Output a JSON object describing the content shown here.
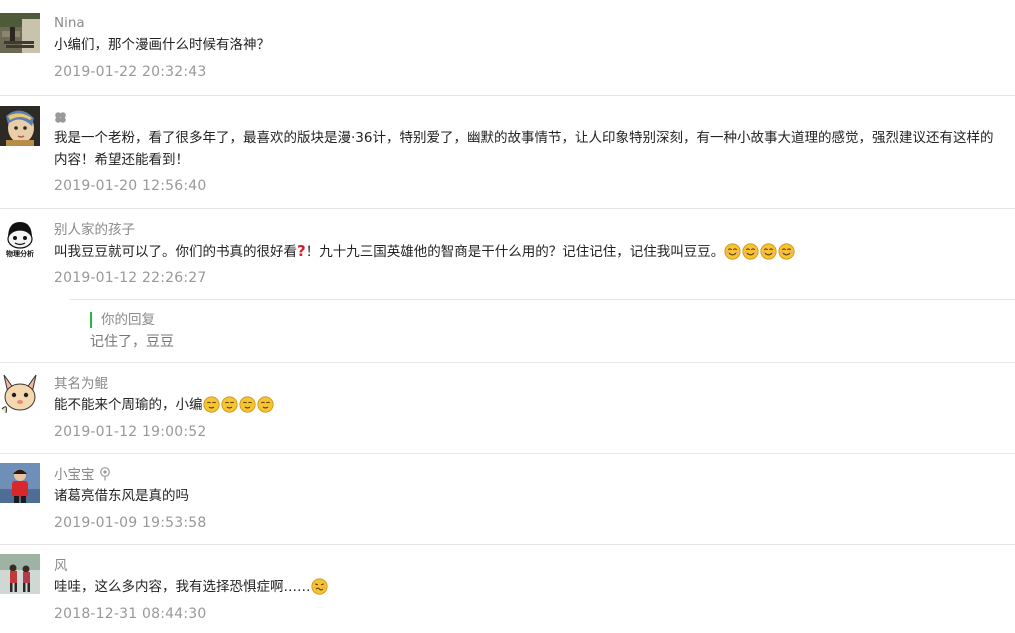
{
  "comments": [
    {
      "author": "Nina",
      "text": "小编们，那个漫画什么时候有洛神？",
      "time": "2019-01-22 20:32:43"
    },
    {
      "author": "",
      "text": "我是一个老粉，看了很多年了，最喜欢的版块是漫·36计，特别爱了，幽默的故事情节，让人印象特别深刻，有一种小故事大道理的感觉，强烈建议还有这样的内容！希望还能看到！",
      "time": "2019-01-20 12:56:40"
    },
    {
      "author": "别人家的孩子",
      "text": "叫我豆豆就可以了。你们的书真的很好看",
      "text2": "！九十九三国英雄他的智商是干什么用的？记住记住，记住我叫豆豆。",
      "time": "2019-01-12 22:26:27",
      "avatar_label": "物理分析",
      "reply": {
        "label": "你的回复",
        "text": "记住了，豆豆"
      }
    },
    {
      "author": "其名为鲲",
      "text": "能不能来个周瑜的，小编",
      "time": "2019-01-12 19:00:52"
    },
    {
      "author": "小宝宝",
      "text": "诸葛亮借东风是真的吗",
      "time": "2019-01-09 19:53:58"
    },
    {
      "author": "风",
      "text": "哇哇，这么多内容，我有选择恐惧症啊……",
      "time": "2018-12-31 08:44:30"
    }
  ],
  "icons": {
    "clover": "clover-icon",
    "question": "red-question-mark-icon",
    "smile": "smile-emoji-icon",
    "blush": "blush-emoji-icon",
    "pin": "location-pin-icon",
    "woozy": "woozy-emoji-icon"
  },
  "colors": {
    "reply_bar": "#2bb34a",
    "question": "#d8202a",
    "emoji": "#f7c431"
  }
}
